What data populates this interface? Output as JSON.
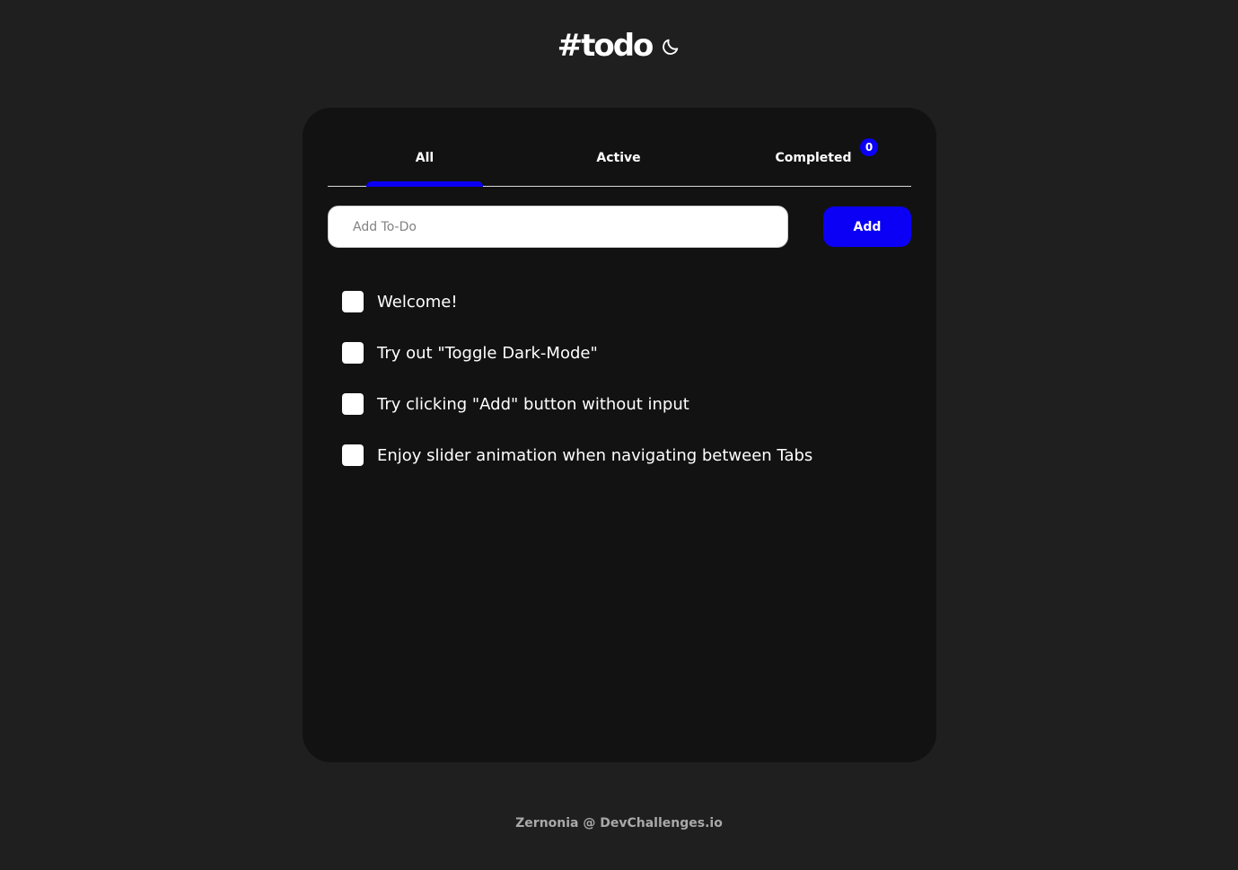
{
  "header": {
    "title": "#todo",
    "theme_toggle_icon": "moon-icon"
  },
  "tabs": [
    {
      "label": "All",
      "selected": true
    },
    {
      "label": "Active",
      "selected": false
    },
    {
      "label": "Completed",
      "selected": false
    }
  ],
  "completed_count": "0",
  "input": {
    "placeholder": "Add To-Do",
    "value": ""
  },
  "add_button": {
    "label": "Add"
  },
  "todos": [
    {
      "text": "Welcome!",
      "checked": false
    },
    {
      "text": "Try out \"Toggle Dark-Mode\"",
      "checked": false
    },
    {
      "text": "Try clicking \"Add\" button without input",
      "checked": false
    },
    {
      "text": "Enjoy slider animation when navigating between Tabs",
      "checked": false
    }
  ],
  "footer": {
    "text": "Zernonia @ DevChallenges.io"
  },
  "colors": {
    "accent": "#0b00f5",
    "background": "#1f1f1f",
    "card": "#121212"
  }
}
